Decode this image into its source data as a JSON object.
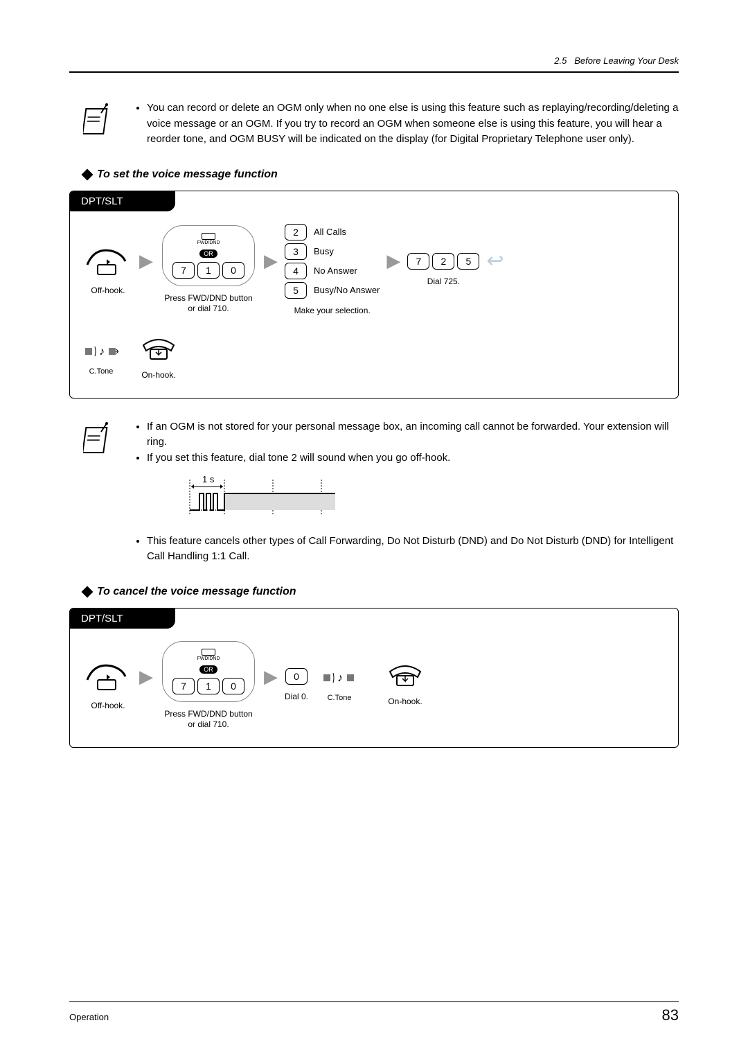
{
  "header": {
    "section_num": "2.5",
    "section_title": "Before Leaving Your Desk"
  },
  "note1": {
    "bullet1": "You can record or delete an OGM only when no one else is using this feature such as replaying/recording/deleting a voice message or an OGM. If you try to record an OGM when someone else is using this feature, you will hear a reorder tone, and OGM BUSY will be indicated on the display (for Digital Proprietary Telephone user only)."
  },
  "heading1": "To set the voice message function",
  "proc1": {
    "title": "DPT/SLT",
    "step1": "Off-hook.",
    "step2_fwd_label": "FWD/DND",
    "step2_or": "OR",
    "step2_keys": [
      "7",
      "1",
      "0"
    ],
    "step2_cap": "Press FWD/DND button or dial 710.",
    "step3_opts": [
      {
        "k": "2",
        "t": "All Calls"
      },
      {
        "k": "3",
        "t": "Busy"
      },
      {
        "k": "4",
        "t": "No Answer"
      },
      {
        "k": "5",
        "t": "Busy/No Answer"
      }
    ],
    "step3_cap": "Make  your selection.",
    "step4_keys": [
      "7",
      "2",
      "5"
    ],
    "step4_cap": "Dial 725.",
    "ctone": "C.Tone",
    "onhook": "On-hook."
  },
  "note2": {
    "b1": "If an OGM is not stored for your personal message box, an incoming call cannot be forwarded. Your extension will ring.",
    "b2": "If you set this feature, dial tone 2 will sound when you go off-hook.",
    "b3": "This feature cancels other types of Call Forwarding, Do Not Disturb (DND) and Do Not Disturb (DND) for Intelligent Call Handling 1:1 Call."
  },
  "chart_data": {
    "type": "line",
    "title": "",
    "xlabel": "",
    "ylabel": "",
    "x_unit": "s",
    "annotation": "1 s",
    "pattern": "Short burst of 3 pulses within first 1s, then continuous tone",
    "segments": [
      {
        "start": 0.0,
        "end": 0.2,
        "level": 0
      },
      {
        "start": 0.2,
        "end": 0.3,
        "level": 1
      },
      {
        "start": 0.3,
        "end": 0.4,
        "level": 0
      },
      {
        "start": 0.4,
        "end": 0.5,
        "level": 1
      },
      {
        "start": 0.5,
        "end": 0.6,
        "level": 0
      },
      {
        "start": 0.6,
        "end": 0.7,
        "level": 1
      },
      {
        "start": 0.7,
        "end": 1.0,
        "level": 0
      },
      {
        "start": 1.0,
        "end": 4.0,
        "level": 1
      }
    ],
    "ylim": [
      0,
      1
    ]
  },
  "heading2": "To cancel the voice message function",
  "proc2": {
    "title": "DPT/SLT",
    "step1": "Off-hook.",
    "step2_fwd_label": "FWD/DND",
    "step2_or": "OR",
    "step2_keys": [
      "7",
      "1",
      "0"
    ],
    "step2_cap": "Press FWD/DND button or dial 710.",
    "step3_key": "0",
    "step3_cap": "Dial 0.",
    "ctone": "C.Tone",
    "onhook": "On-hook."
  },
  "footer": {
    "left": "Operation",
    "page": "83"
  }
}
